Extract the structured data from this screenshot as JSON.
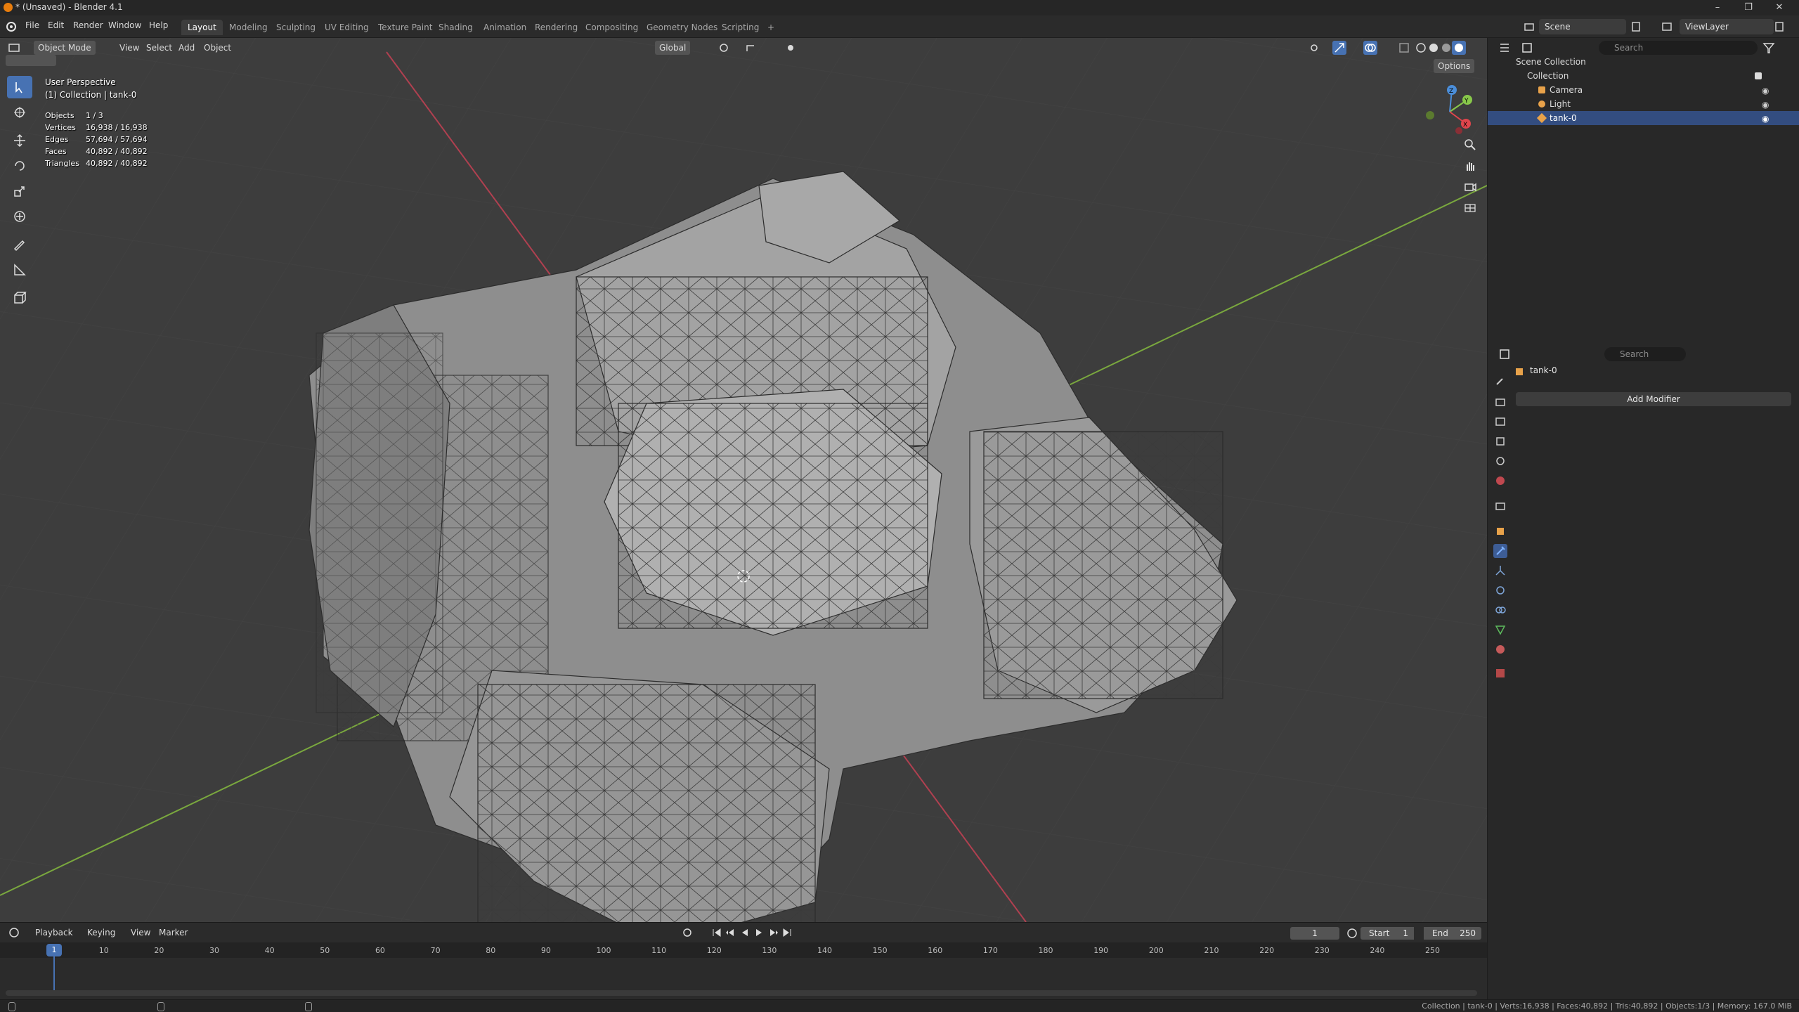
{
  "window": {
    "title": "* (Unsaved) - Blender 4.1",
    "controls": [
      "–",
      "❐",
      "✕"
    ]
  },
  "menu": {
    "items": [
      "File",
      "Edit",
      "Render",
      "Window",
      "Help"
    ]
  },
  "workspaces": {
    "tabs": [
      "Layout",
      "Modeling",
      "Sculpting",
      "UV Editing",
      "Texture Paint",
      "Shading",
      "Animation",
      "Rendering",
      "Compositing",
      "Geometry Nodes",
      "Scripting"
    ],
    "active": "Layout",
    "add": "+"
  },
  "scene": {
    "label": "Scene",
    "view_layer": "ViewLayer"
  },
  "viewport_header": {
    "mode": "Object Mode",
    "menus": [
      "View",
      "Select",
      "Add",
      "Object"
    ],
    "transform_orientation": "Global",
    "options": "Options"
  },
  "viewport_overlay": {
    "perspective": "User Perspective",
    "collection": "(1) Collection | tank-0",
    "stats": [
      {
        "label": "Objects",
        "value": "1 / 3"
      },
      {
        "label": "Vertices",
        "value": "16,938 / 16,938"
      },
      {
        "label": "Edges",
        "value": "57,694 / 57,694"
      },
      {
        "label": "Faces",
        "value": "40,892 / 40,892"
      },
      {
        "label": "Triangles",
        "value": "40,892 / 40,892"
      }
    ]
  },
  "gizmo": {
    "x": "X",
    "y": "Y",
    "z": "Z"
  },
  "outliner": {
    "search_placeholder": "Search",
    "root": "Scene Collection",
    "collection": "Collection",
    "items": [
      {
        "name": "Camera",
        "icon": "camera-icon"
      },
      {
        "name": "Light",
        "icon": "light-icon"
      },
      {
        "name": "tank-0",
        "icon": "mesh-icon",
        "selected": true
      }
    ]
  },
  "properties": {
    "search_placeholder": "Search",
    "object_name": "tank-0",
    "add_modifier": "Add Modifier"
  },
  "timeline": {
    "menus": [
      "Playback",
      "Keying",
      "View",
      "Marker"
    ],
    "current_frame": "1",
    "start_label": "Start",
    "start": "1",
    "end_label": "End",
    "end": "250",
    "ticks": [
      "10",
      "20",
      "30",
      "40",
      "50",
      "60",
      "70",
      "80",
      "90",
      "100",
      "110",
      "120",
      "130",
      "140",
      "150",
      "160",
      "170",
      "180",
      "190",
      "200",
      "210",
      "220",
      "230",
      "240",
      "250"
    ],
    "playhead_label": "1"
  },
  "statusbar": {
    "text": "Collection | tank-0 | Verts:16,938 | Faces:40,892 | Tris:40,892 | Objects:1/3 | Memory: 167.0 MiB"
  },
  "colors": {
    "accent": "#4772b3",
    "selection": "#334d80",
    "x_axis": "#e0454c",
    "y_axis": "#88c84a",
    "z_axis": "#4b8ed9"
  }
}
